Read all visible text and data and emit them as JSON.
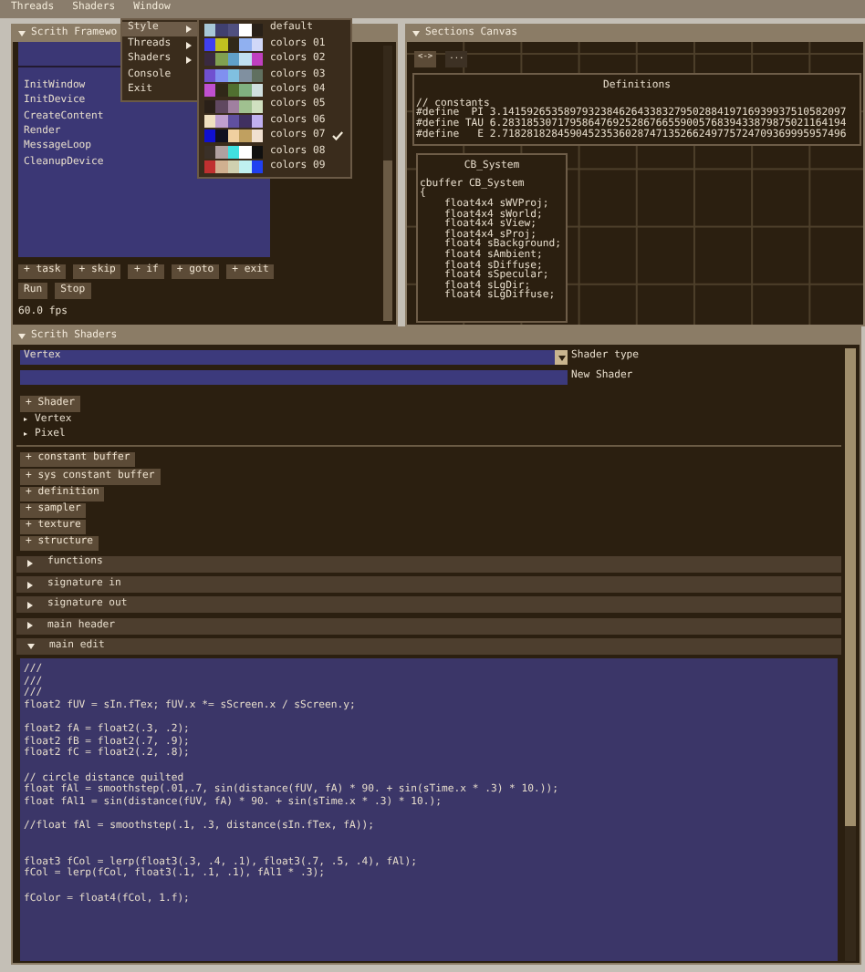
{
  "menubar": [
    "Threads",
    "Shaders",
    "Window"
  ],
  "window_menu": {
    "items": [
      {
        "label": "Style",
        "kind": "submenu",
        "selected": true
      },
      {
        "label": "Threads",
        "kind": "submenu",
        "selected": false
      },
      {
        "label": "Shaders",
        "kind": "submenu",
        "selected": false
      },
      {
        "label": "Console",
        "kind": "item",
        "selected": false
      },
      {
        "label": "Exit",
        "kind": "item",
        "selected": false
      }
    ]
  },
  "style_menu": {
    "items": [
      {
        "label": "default",
        "swatches": [
          {
            "color": "#a8c8d8"
          },
          {
            "color": "#404070"
          },
          {
            "color": "#505080"
          },
          {
            "color": "#ffffff"
          },
          {
            "color": "#282018"
          }
        ],
        "checked": false
      },
      {
        "label": "colors 01",
        "swatches": [
          {
            "color": "#4040f0"
          },
          {
            "color": "#c0c020"
          },
          {
            "color": "#302818"
          },
          {
            "color": "#90b0f0"
          },
          {
            "color": "#d0d8f8"
          }
        ],
        "checked": false
      },
      {
        "label": "colors 02",
        "swatches": [
          {
            "color": "#3a2a40"
          },
          {
            "color": "#80a050"
          },
          {
            "color": "#60a0c8"
          },
          {
            "color": "#c0e0f0"
          },
          {
            "color": "#c040c0"
          }
        ],
        "checked": false
      },
      {
        "label": "colors 03",
        "swatches": [
          {
            "color": "#7050d0"
          },
          {
            "color": "#8090f0"
          },
          {
            "color": "#80c0e0"
          },
          {
            "color": "#8090a0"
          },
          {
            "color": "#607060"
          }
        ],
        "checked": false
      },
      {
        "label": "colors 04",
        "swatches": [
          {
            "color": "#c050d0"
          },
          {
            "color": "#302818"
          },
          {
            "color": "#507030"
          },
          {
            "color": "#80b080"
          },
          {
            "color": "#d0e0e0"
          }
        ],
        "checked": false
      },
      {
        "label": "colors 05",
        "swatches": [
          {
            "color": "#2a2018"
          },
          {
            "color": "#604860"
          },
          {
            "color": "#a080a0"
          },
          {
            "color": "#a0c090"
          },
          {
            "color": "#d0e0c0"
          }
        ],
        "checked": false
      },
      {
        "label": "colors 06",
        "swatches": [
          {
            "color": "#f0e0c0"
          },
          {
            "color": "#c0a0d0"
          },
          {
            "color": "#6050a0"
          },
          {
            "color": "#403060"
          },
          {
            "color": "#c0b0f0"
          }
        ],
        "checked": false
      },
      {
        "label": "colors 07",
        "swatches": [
          {
            "color": "#1010d0"
          },
          {
            "color": "#101020"
          },
          {
            "color": "#f0d0a0"
          },
          {
            "color": "#c0a060"
          },
          {
            "color": "#f0e0d0"
          }
        ],
        "checked": true
      },
      {
        "label": "colors 08",
        "swatches": [
          {
            "color": "#3a3028"
          },
          {
            "color": "#b0a0a0"
          },
          {
            "color": "#40e0e0"
          },
          {
            "color": "#ffffff"
          },
          {
            "color": "#101010"
          }
        ],
        "checked": false
      },
      {
        "label": "colors 09",
        "swatches": [
          {
            "color": "#c03030"
          },
          {
            "color": "#d0b090"
          },
          {
            "color": "#d0d0b0"
          },
          {
            "color": "#c0f0f0"
          },
          {
            "color": "#2040f0"
          }
        ],
        "checked": false
      }
    ]
  },
  "framework": {
    "title": "Scrith Framewo",
    "list": [
      "InitWindow",
      "InitDevice",
      "CreateContent",
      "Render",
      "MessageLoop",
      "CleanupDevice"
    ],
    "task_buttons": [
      "+ task",
      "+ skip",
      "+ if",
      "+ goto",
      "+ exit"
    ],
    "run_buttons": [
      "Run",
      "Stop"
    ],
    "fps": "60.0 fps"
  },
  "canvas": {
    "title": "Sections Canvas",
    "buttons": [
      "<->",
      "..."
    ],
    "definitions": {
      "title": "Definitions",
      "text": "// constants\n#define  PI 3.14159265358979323846264338327950288419716939937510582097\n#define TAU 6.28318530717958647692528676655900576839433879875021164194\n#define   E 2.71828182845904523536028747135266249775724709369995957496"
    },
    "cb_system": {
      "title": "CB_System",
      "text": "cbuffer CB_System\n{\n    float4x4 sWVProj;\n    float4x4 sWorld;\n    float4x4 sView;\n    float4x4 sProj;\n    float4 sBackground;\n    float4 sAmbient;\n    float4 sDiffuse;\n    float4 sSpecular;\n    float4 sLgDir;\n    float4 sLgDiffuse;"
    }
  },
  "shaders": {
    "title": "Scrith Shaders",
    "shader_type": {
      "value": "Vertex",
      "label": "Shader type"
    },
    "new_shader": {
      "label": "New Shader"
    },
    "add_shader_button": "+ Shader",
    "shader_list": [
      "Vertex",
      "Pixel"
    ],
    "add_buttons": [
      "+ constant buffer",
      "+ sys constant buffer",
      "+ definition",
      "+ sampler",
      "+ texture",
      "+ structure"
    ],
    "sections": [
      {
        "label": "functions",
        "expanded": false
      },
      {
        "label": "signature in",
        "expanded": false
      },
      {
        "label": "signature out",
        "expanded": false
      },
      {
        "label": "main header",
        "expanded": false
      },
      {
        "label": "main edit",
        "expanded": true
      }
    ],
    "code": "///\n///\n///\nfloat2 fUV = sIn.fTex; fUV.x *= sScreen.x / sScreen.y;\n\nfloat2 fA = float2(.3, .2);\nfloat2 fB = float2(.7, .9);\nfloat2 fC = float2(.2, .8);\n\n// circle distance quilted\nfloat fAl = smoothstep(.01,.7, sin(distance(fUV, fA) * 90. + sin(sTime.x * .3) * 10.));\nfloat fAl1 = sin(distance(fUV, fA) * 90. + sin(sTime.x * .3) * 10.);\n\n//float fAl = smoothstep(.1, .3, distance(sIn.fTex, fA));\n\n\nfloat3 fCol = lerp(float3(.3, .4, .1), float3(.7, .5, .4), fAl);\nfCol = lerp(fCol, float3(.1, .1, .1), fAl1 * .3);\n\nfColor = float4(fCol, 1.f);"
  }
}
